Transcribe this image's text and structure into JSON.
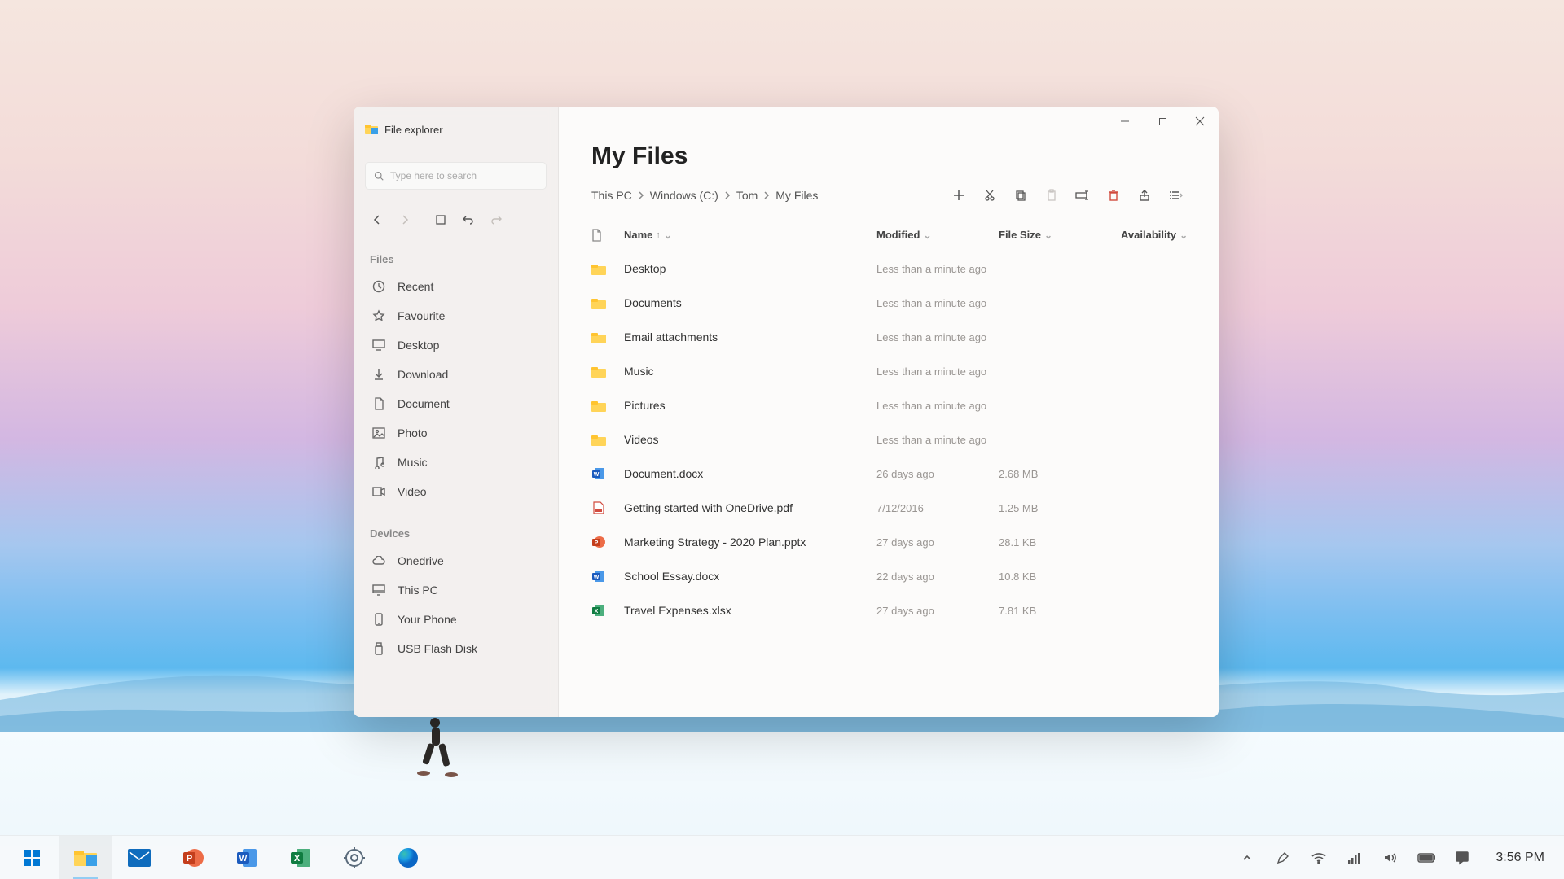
{
  "window": {
    "title": "File explorer",
    "search_placeholder": "Type here to search"
  },
  "sidebar": {
    "sections": [
      {
        "heading": "Files",
        "items": [
          {
            "icon": "clock",
            "label": "Recent"
          },
          {
            "icon": "star",
            "label": "Favourite"
          },
          {
            "icon": "desktop",
            "label": "Desktop"
          },
          {
            "icon": "download",
            "label": "Download"
          },
          {
            "icon": "document",
            "label": "Document"
          },
          {
            "icon": "photo",
            "label": "Photo"
          },
          {
            "icon": "music",
            "label": "Music"
          },
          {
            "icon": "video",
            "label": "Video"
          }
        ]
      },
      {
        "heading": "Devices",
        "items": [
          {
            "icon": "cloud",
            "label": "Onedrive"
          },
          {
            "icon": "pc",
            "label": "This PC"
          },
          {
            "icon": "phone",
            "label": "Your Phone"
          },
          {
            "icon": "usb",
            "label": "USB Flash Disk"
          }
        ]
      }
    ]
  },
  "page": {
    "title": "My Files",
    "breadcrumbs": [
      "This PC",
      "Windows (C:)",
      "Tom",
      "My Files"
    ]
  },
  "columns": {
    "name": "Name",
    "modified": "Modified",
    "size": "File Size",
    "availability": "Availability",
    "sort_indicator": "↑"
  },
  "files": [
    {
      "type": "folder",
      "name": "Desktop",
      "modified": "Less than a minute ago",
      "size": "",
      "availability": ""
    },
    {
      "type": "folder",
      "name": "Documents",
      "modified": "Less than a minute ago",
      "size": "",
      "availability": ""
    },
    {
      "type": "folder",
      "name": "Email attachments",
      "modified": "Less than a minute ago",
      "size": "",
      "availability": ""
    },
    {
      "type": "folder",
      "name": "Music",
      "modified": "Less than a minute ago",
      "size": "",
      "availability": ""
    },
    {
      "type": "folder",
      "name": "Pictures",
      "modified": "Less than a minute ago",
      "size": "",
      "availability": ""
    },
    {
      "type": "folder",
      "name": "Videos",
      "modified": "Less than a minute ago",
      "size": "",
      "availability": ""
    },
    {
      "type": "word",
      "name": "Document.docx",
      "modified": "26 days ago",
      "size": "2.68 MB",
      "availability": ""
    },
    {
      "type": "pdf",
      "name": "Getting started with OneDrive.pdf",
      "modified": "7/12/2016",
      "size": "1.25 MB",
      "availability": ""
    },
    {
      "type": "ppt",
      "name": "Marketing Strategy - 2020 Plan.pptx",
      "modified": "27 days ago",
      "size": "28.1 KB",
      "availability": ""
    },
    {
      "type": "word",
      "name": "School Essay.docx",
      "modified": "22 days ago",
      "size": "10.8 KB",
      "availability": ""
    },
    {
      "type": "excel",
      "name": "Travel Expenses.xlsx",
      "modified": "27 days ago",
      "size": "7.81 KB",
      "availability": ""
    }
  ],
  "taskbar": {
    "clock": "3:56 PM"
  }
}
